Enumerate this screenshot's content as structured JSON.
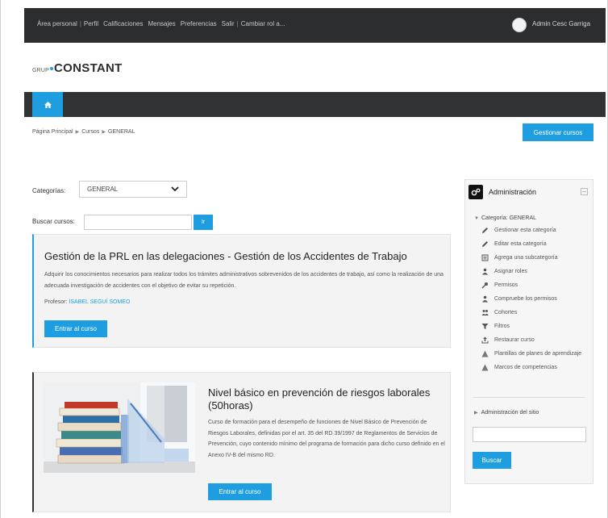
{
  "topnav": {
    "links": [
      "Área personal",
      "Perfil",
      "Calificaciones",
      "Mensajes",
      "Preferencias",
      "Salir",
      "Cambiar rol a..."
    ],
    "separator": "|",
    "user_name": "Admin Cesc Garriga"
  },
  "logo": {
    "prefix": "GRUP",
    "name": "CONSTANT"
  },
  "breadcrumb": [
    "Página Principal",
    "Cursos",
    "GENERAL"
  ],
  "manage_courses_label": "Gestionar cursos",
  "categories": {
    "label": "Categorías:",
    "selected": "GENERAL"
  },
  "course_search": {
    "label": "Buscar cursos:",
    "value": "",
    "button_label": "Ir"
  },
  "courses": [
    {
      "title": "Gestión de la PRL en las delegaciones - Gestión de los Accidentes de Trabajo",
      "description": "Adquirir los conocimientos necesarios para realizar todos los trámites administrativos sobrevenidos de los accidentes de trabajo, así como la realización de una adecuada investigación de accidentes con el objetivo de evitar su repetición.",
      "teacher_label": "Profesor:",
      "teacher_name": "ISABEL SEGUÍ SOMEO",
      "button_label": "Entrar al curso"
    },
    {
      "title": "Nivel básico en prevención de riesgos laborales (50horas)",
      "description": "Curso de formación para el desempeño de funciones de Nivel Básico de Prevención de Riesgos Laborales, definidas por el art. 35 del RD 39/1997 de Reglamentos de Servicios de Prevención, cuyo contenido mínimo del programa de formación para dicho curso definido en el Anexo IV-B del mismo RD.",
      "button_label": "Entrar al curso"
    }
  ],
  "admin": {
    "title": "Administración",
    "category_label": "Categoría: GENERAL",
    "items": [
      {
        "label": "Gestionar esta categoría",
        "icon": "pencil-icon"
      },
      {
        "label": "Editar esta categoría",
        "icon": "pencil-icon"
      },
      {
        "label": "Agrega una subcategoría",
        "icon": "add-subcategory-icon"
      },
      {
        "label": "Asignar roles",
        "icon": "user-icon"
      },
      {
        "label": "Permisos",
        "icon": "key-icon"
      },
      {
        "label": "Compruebe los permisos",
        "icon": "user-check-icon"
      },
      {
        "label": "Cohortes",
        "icon": "users-icon"
      },
      {
        "label": "Filtros",
        "icon": "filter-icon"
      },
      {
        "label": "Restaurar curso",
        "icon": "upload-icon"
      },
      {
        "label": "Plantillas de planes de aprendizaje",
        "icon": "warning-icon"
      },
      {
        "label": "Marcos de competencias",
        "icon": "warning-icon"
      }
    ],
    "site_admin_label": "Administración del sitio",
    "search_value": "",
    "search_button_label": "Buscar"
  },
  "colors": {
    "accent": "#1e9ee0",
    "navbar": "#2b2d2f",
    "card_bg": "#f3f3f3"
  }
}
